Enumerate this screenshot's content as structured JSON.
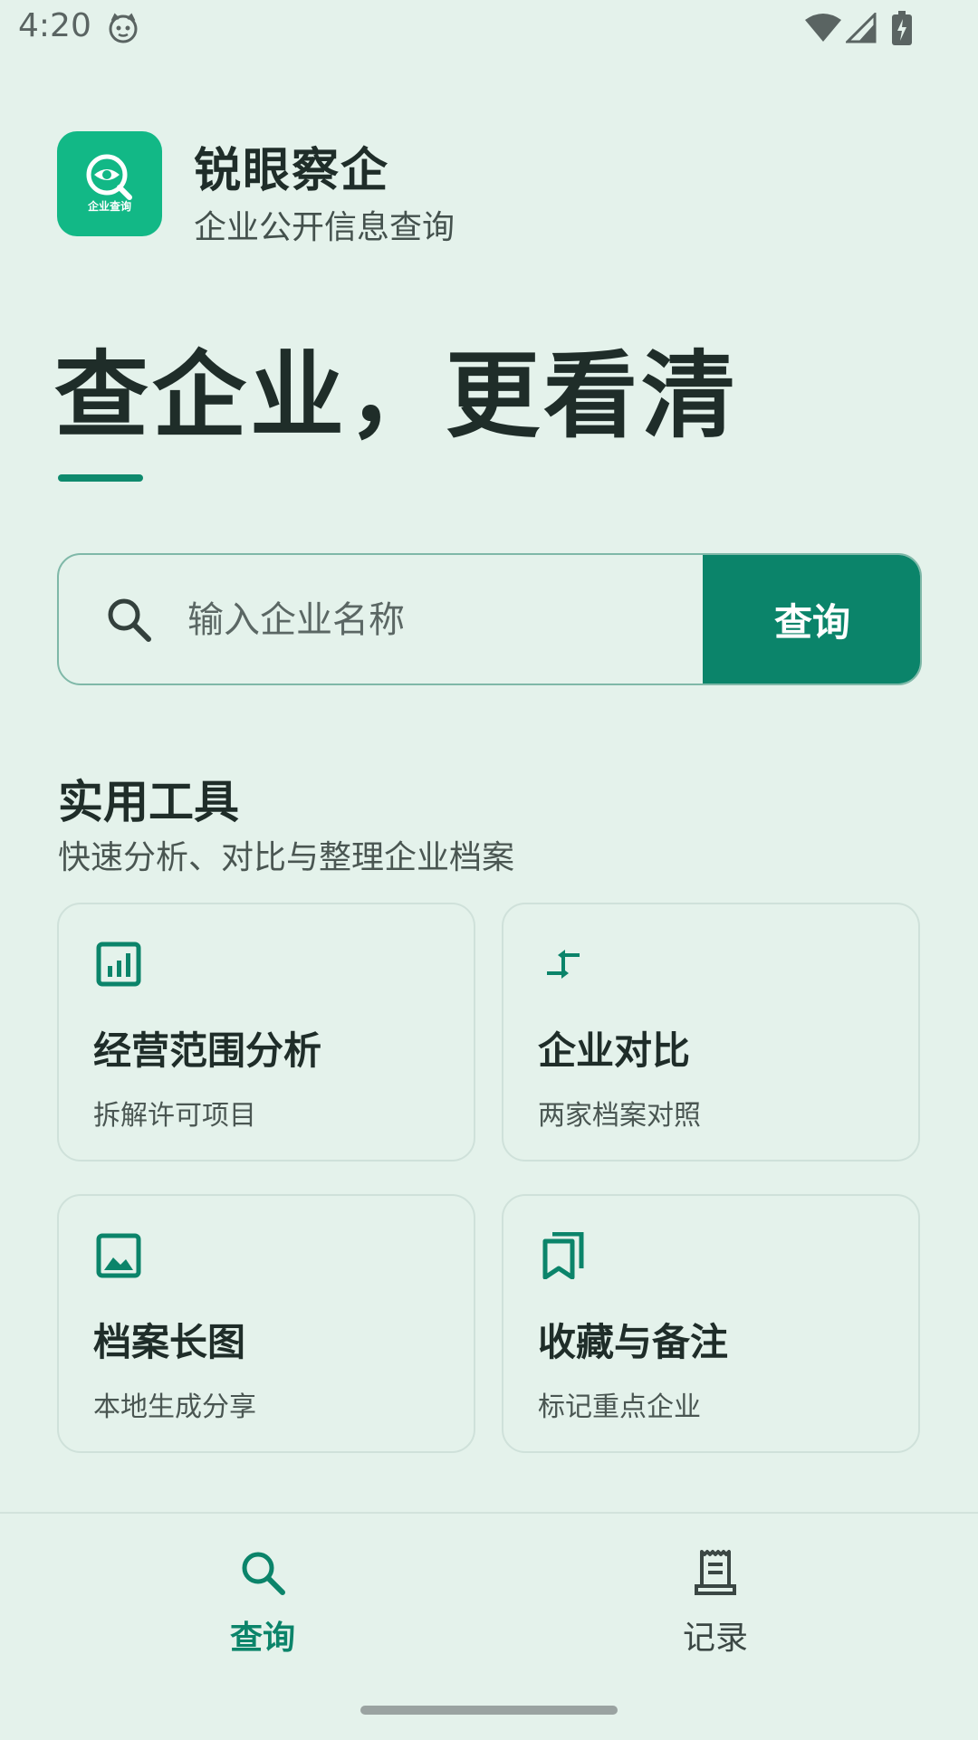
{
  "status_bar": {
    "time": "4:20"
  },
  "app": {
    "title": "锐眼察企",
    "subtitle": "企业公开信息查询",
    "logo_text": "企业查询"
  },
  "hero": {
    "headline": "查企业，更看清"
  },
  "search": {
    "placeholder": "输入企业名称",
    "value": "",
    "button_label": "查询"
  },
  "tools": {
    "title": "实用工具",
    "subtitle": "快速分析、对比与整理企业档案",
    "items": [
      {
        "title": "经营范围分析",
        "subtitle": "拆解许可项目",
        "icon": "bar-chart-icon"
      },
      {
        "title": "企业对比",
        "subtitle": "两家档案对照",
        "icon": "compare-arrows-icon"
      },
      {
        "title": "档案长图",
        "subtitle": "本地生成分享",
        "icon": "image-icon"
      },
      {
        "title": "收藏与备注",
        "subtitle": "标记重点企业",
        "icon": "bookmarks-icon"
      }
    ]
  },
  "bottom_nav": {
    "items": [
      {
        "label": "查询",
        "icon": "search-icon",
        "active": true
      },
      {
        "label": "记录",
        "icon": "receipt-icon",
        "active": false
      }
    ]
  },
  "colors": {
    "accent": "#0b846a",
    "background": "#e4f2eb",
    "text": "#1f2d29",
    "inactive": "#4a5652"
  }
}
